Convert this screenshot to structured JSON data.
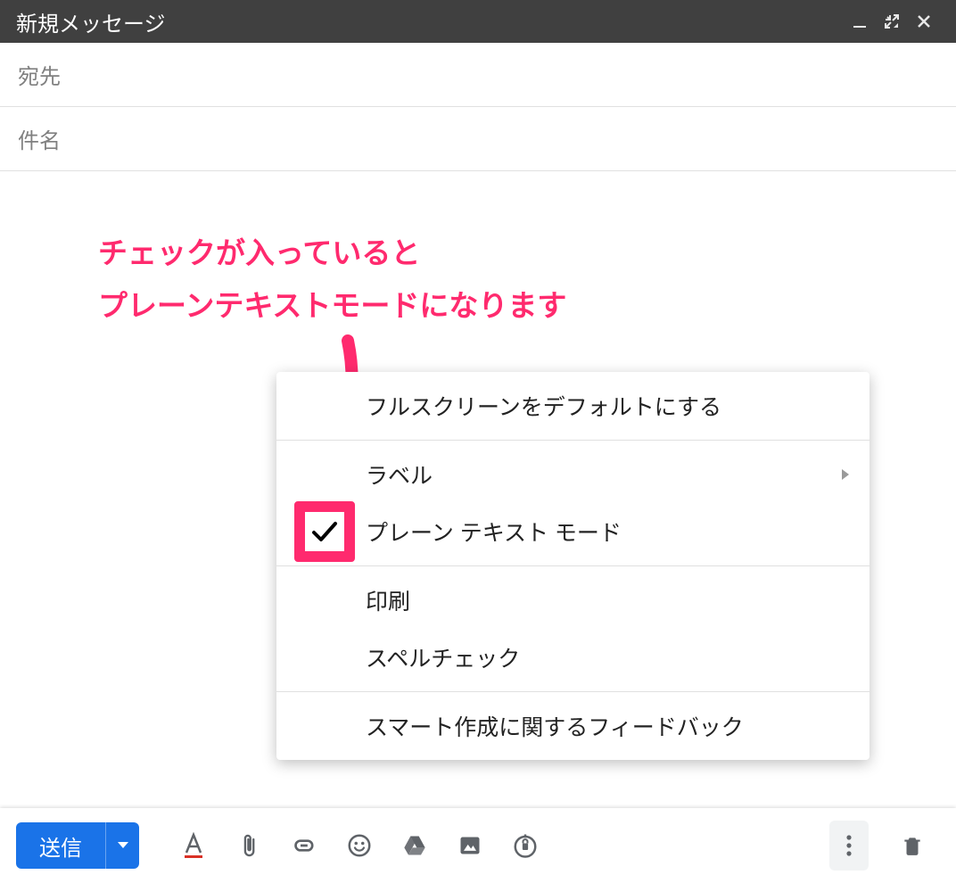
{
  "titlebar": {
    "title": "新規メッセージ"
  },
  "fields": {
    "to_placeholder": "宛先",
    "subject_placeholder": "件名"
  },
  "annotation": {
    "line1": "チェックが入っていると",
    "line2": "プレーンテキストモードになります"
  },
  "menu": {
    "fullscreen_default": "フルスクリーンをデフォルトにする",
    "label": "ラベル",
    "plain_text_mode": "プレーン テキスト モード",
    "print": "印刷",
    "spell_check": "スペルチェック",
    "smart_compose_feedback": "スマート作成に関するフィードバック"
  },
  "toolbar": {
    "send_label": "送信"
  }
}
